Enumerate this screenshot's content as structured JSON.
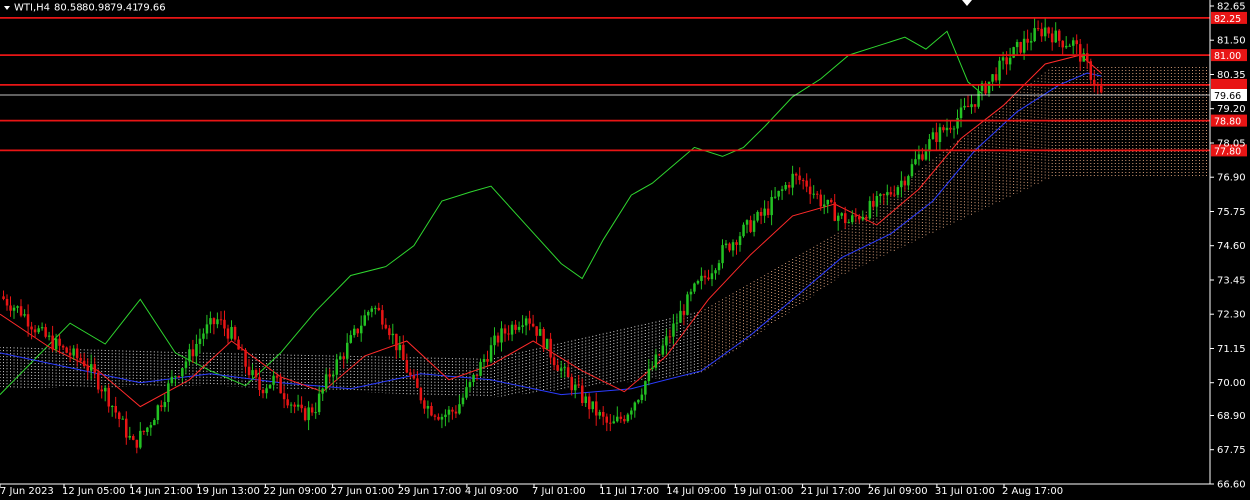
{
  "chart_data": {
    "type": "candlestick",
    "symbol": "WTI,H4",
    "ohlc": [
      "80.58",
      "80.98",
      "79.41",
      "79.66"
    ],
    "current_price": 79.66,
    "ylim": [
      66.6,
      82.85
    ],
    "y_ticks": [
      "82.65",
      "81.50",
      "80.35",
      "79.20",
      "78.05",
      "76.90",
      "75.75",
      "74.60",
      "73.45",
      "72.30",
      "71.15",
      "70.00",
      "68.90",
      "67.75",
      "66.60"
    ],
    "x_ticks": [
      "7 Jun 2023",
      "12 Jun 05:00",
      "14 Jun 21:00",
      "19 Jun 13:00",
      "22 Jun 09:00",
      "27 Jun 01:00",
      "29 Jun 17:00",
      "4 Jul 09:00",
      "7 Jul 01:00",
      "11 Jul 17:00",
      "14 Jul 09:00",
      "19 Jul 01:00",
      "21 Jul 17:00",
      "26 Jul 09:00",
      "31 Jul 01:00",
      "2 Aug 17:00"
    ],
    "levels": [
      {
        "value": 82.25,
        "label": "82.25"
      },
      {
        "value": 81.0,
        "label": "81.00"
      },
      {
        "value": 80.0,
        "label": ""
      },
      {
        "value": 78.8,
        "label": "78.80"
      },
      {
        "value": 77.8,
        "label": "77.80"
      }
    ],
    "support_line_value": 79.66,
    "close_path": [
      [
        0,
        72.9
      ],
      [
        6,
        72.4
      ],
      [
        12,
        71.6
      ],
      [
        18,
        71.1
      ],
      [
        24,
        70.7
      ],
      [
        30,
        69.7
      ],
      [
        34,
        68.8
      ],
      [
        38,
        67.9
      ],
      [
        42,
        68.5
      ],
      [
        46,
        69.4
      ],
      [
        50,
        70.3
      ],
      [
        54,
        70.9
      ],
      [
        58,
        71.7
      ],
      [
        62,
        72.1
      ],
      [
        66,
        71.6
      ],
      [
        70,
        70.6
      ],
      [
        74,
        69.8
      ],
      [
        78,
        70.1
      ],
      [
        82,
        69.5
      ],
      [
        86,
        68.9
      ],
      [
        90,
        69.2
      ],
      [
        94,
        70.3
      ],
      [
        98,
        71.0
      ],
      [
        102,
        71.8
      ],
      [
        106,
        72.6
      ],
      [
        110,
        72.1
      ],
      [
        114,
        71.0
      ],
      [
        118,
        69.9
      ],
      [
        122,
        69.2
      ],
      [
        126,
        68.9
      ],
      [
        130,
        69.1
      ],
      [
        134,
        69.9
      ],
      [
        138,
        70.8
      ],
      [
        142,
        71.5
      ],
      [
        146,
        71.9
      ],
      [
        150,
        72.3
      ],
      [
        154,
        71.6
      ],
      [
        158,
        70.8
      ],
      [
        162,
        70.1
      ],
      [
        166,
        69.5
      ],
      [
        170,
        69.0
      ],
      [
        174,
        68.5
      ],
      [
        178,
        68.9
      ],
      [
        182,
        69.6
      ],
      [
        186,
        70.5
      ],
      [
        190,
        71.4
      ],
      [
        194,
        72.3
      ],
      [
        198,
        73.1
      ],
      [
        202,
        73.7
      ],
      [
        206,
        74.4
      ],
      [
        210,
        74.9
      ],
      [
        214,
        75.3
      ],
      [
        218,
        75.7
      ],
      [
        222,
        76.3
      ],
      [
        226,
        76.9
      ],
      [
        230,
        76.7
      ],
      [
        234,
        76.1
      ],
      [
        238,
        75.7
      ],
      [
        242,
        75.4
      ],
      [
        246,
        75.7
      ],
      [
        250,
        76.0
      ],
      [
        254,
        76.4
      ],
      [
        258,
        76.9
      ],
      [
        262,
        77.6
      ],
      [
        266,
        78.2
      ],
      [
        270,
        78.6
      ],
      [
        274,
        79.0
      ],
      [
        278,
        79.5
      ],
      [
        282,
        80.1
      ],
      [
        286,
        80.7
      ],
      [
        290,
        81.2
      ],
      [
        294,
        81.6
      ],
      [
        298,
        81.9
      ],
      [
        302,
        81.5
      ],
      [
        306,
        81.4
      ],
      [
        310,
        80.6
      ],
      [
        314,
        79.66
      ]
    ],
    "tenkan_path": [
      [
        0,
        72.3
      ],
      [
        14,
        71.2
      ],
      [
        28,
        70.4
      ],
      [
        40,
        69.2
      ],
      [
        54,
        70.1
      ],
      [
        66,
        71.4
      ],
      [
        80,
        70.2
      ],
      [
        92,
        69.7
      ],
      [
        104,
        70.9
      ],
      [
        116,
        71.4
      ],
      [
        128,
        70.1
      ],
      [
        140,
        70.6
      ],
      [
        152,
        71.4
      ],
      [
        166,
        70.4
      ],
      [
        178,
        69.7
      ],
      [
        190,
        70.9
      ],
      [
        202,
        72.8
      ],
      [
        214,
        74.3
      ],
      [
        226,
        75.6
      ],
      [
        238,
        76.0
      ],
      [
        250,
        75.3
      ],
      [
        262,
        76.5
      ],
      [
        274,
        78.2
      ],
      [
        286,
        79.3
      ],
      [
        298,
        80.7
      ],
      [
        308,
        81.0
      ],
      [
        314,
        80.4
      ]
    ],
    "kijun_path": [
      [
        0,
        71.0
      ],
      [
        20,
        70.5
      ],
      [
        40,
        70.0
      ],
      [
        60,
        70.3
      ],
      [
        80,
        70.0
      ],
      [
        100,
        69.8
      ],
      [
        120,
        70.3
      ],
      [
        140,
        70.1
      ],
      [
        160,
        69.6
      ],
      [
        180,
        69.8
      ],
      [
        200,
        70.4
      ],
      [
        214,
        71.6
      ],
      [
        228,
        73.0
      ],
      [
        240,
        74.2
      ],
      [
        254,
        75.0
      ],
      [
        266,
        76.1
      ],
      [
        278,
        77.8
      ],
      [
        290,
        79.1
      ],
      [
        302,
        80.0
      ],
      [
        310,
        80.4
      ],
      [
        314,
        80.3
      ]
    ],
    "chikou_path": [
      [
        0,
        69.6
      ],
      [
        10,
        70.8
      ],
      [
        20,
        72.0
      ],
      [
        30,
        71.3
      ],
      [
        40,
        72.8
      ],
      [
        50,
        71.0
      ],
      [
        60,
        70.4
      ],
      [
        70,
        69.9
      ],
      [
        80,
        71.0
      ],
      [
        90,
        72.4
      ],
      [
        100,
        73.6
      ],
      [
        110,
        73.9
      ],
      [
        118,
        74.6
      ],
      [
        126,
        76.1
      ],
      [
        134,
        76.4
      ],
      [
        140,
        76.6
      ],
      [
        150,
        75.3
      ],
      [
        160,
        74.0
      ],
      [
        166,
        73.5
      ],
      [
        172,
        74.8
      ],
      [
        180,
        76.3
      ],
      [
        186,
        76.7
      ],
      [
        192,
        77.3
      ],
      [
        198,
        77.9
      ],
      [
        206,
        77.6
      ],
      [
        212,
        77.9
      ],
      [
        218,
        78.6
      ],
      [
        226,
        79.6
      ],
      [
        234,
        80.2
      ],
      [
        242,
        81.0
      ],
      [
        250,
        81.3
      ],
      [
        258,
        81.6
      ],
      [
        264,
        81.2
      ],
      [
        270,
        81.8
      ],
      [
        276,
        80.1
      ],
      [
        280,
        79.7
      ]
    ],
    "cloud_bands": [
      {
        "from": 0,
        "to": 60,
        "top": 71.2,
        "bottom": 69.8,
        "color": "#ffffff"
      },
      {
        "from": 60,
        "to": 140,
        "top": 71.0,
        "bottom": 69.9,
        "color": "#ffffff"
      },
      {
        "from": 140,
        "to": 200,
        "top": 70.8,
        "bottom": 69.5,
        "color": "#ffffff"
      },
      {
        "from": 200,
        "to": 240,
        "top": 72.4,
        "bottom": 70.3,
        "color": "#f5b48a"
      },
      {
        "from": 240,
        "to": 300,
        "top": 75.1,
        "bottom": 73.6,
        "color": "#f5b48a"
      },
      {
        "from": 300,
        "to": 345,
        "top": 80.6,
        "bottom": 76.9,
        "color": "#f5b48a"
      }
    ],
    "colors": {
      "background": "#000000",
      "bull_candle": "#23c223",
      "bear_candle": "#e81515",
      "tenkan": "#ff2a2a",
      "kijun": "#2b3cff",
      "chikou": "#2fd62f",
      "level_line": "#e81515",
      "axis_text": "#ffffff",
      "price_tag": "#ffffff"
    }
  }
}
